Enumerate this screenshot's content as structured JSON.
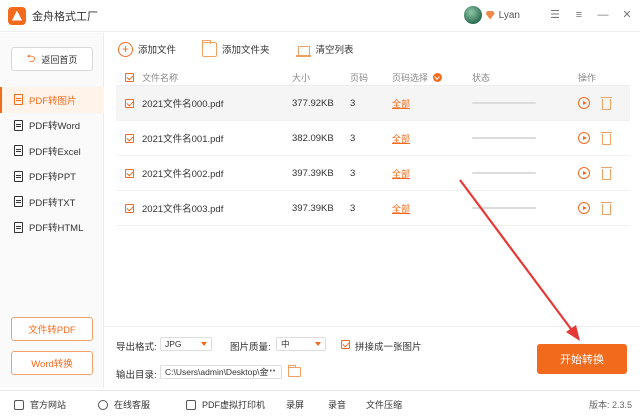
{
  "app": {
    "title": "金舟格式工厂"
  },
  "user": {
    "name": "Lyan"
  },
  "window_controls": {
    "skin": "☰",
    "menu": "≡",
    "minimize": "—",
    "close": "✕"
  },
  "sidebar": {
    "back": "返回首页",
    "items": [
      {
        "label": "PDF转图片"
      },
      {
        "label": "PDF转Word"
      },
      {
        "label": "PDF转Excel"
      },
      {
        "label": "PDF转PPT"
      },
      {
        "label": "PDF转TXT"
      },
      {
        "label": "PDF转HTML"
      }
    ],
    "btn_to_pdf": "文件转PDF",
    "btn_word": "Word转换"
  },
  "toolbar": {
    "add_file": "添加文件",
    "add_folder": "添加文件夹",
    "clear_list": "清空列表"
  },
  "table": {
    "headers": {
      "name": "文件名称",
      "size": "大小",
      "pages": "页码",
      "page_select": "页码选择",
      "status": "状态",
      "ops": "操作"
    },
    "rows": [
      {
        "name": "2021文件名000.pdf",
        "size": "377.92KB",
        "pages": "3",
        "select": "全部",
        "progress": 0
      },
      {
        "name": "2021文件名001.pdf",
        "size": "382.09KB",
        "pages": "3",
        "select": "全部",
        "progress": 0
      },
      {
        "name": "2021文件名002.pdf",
        "size": "397.39KB",
        "pages": "3",
        "select": "全部",
        "progress": 0
      },
      {
        "name": "2021文件名003.pdf",
        "size": "397.39KB",
        "pages": "3",
        "select": "全部",
        "progress": 0
      }
    ]
  },
  "settings": {
    "format_label": "导出格式:",
    "format_value": "JPG",
    "quality_label": "图片质量:",
    "quality_value": "中",
    "merge_label": "拼接成一张图片",
    "output_label": "输出目录:",
    "output_path": "C:\\Users\\admin\\Desktop\\金",
    "more": "•••",
    "start": "开始转换"
  },
  "footer": {
    "website": "官方网站",
    "service": "在线客服",
    "printer": "PDF虚拟打印机",
    "screen": "录屏",
    "audio": "录音",
    "compress": "文件压缩",
    "version": "版本: 2.3.5"
  },
  "colors": {
    "accent": "#f26b1d",
    "arrow": "#e53935"
  }
}
